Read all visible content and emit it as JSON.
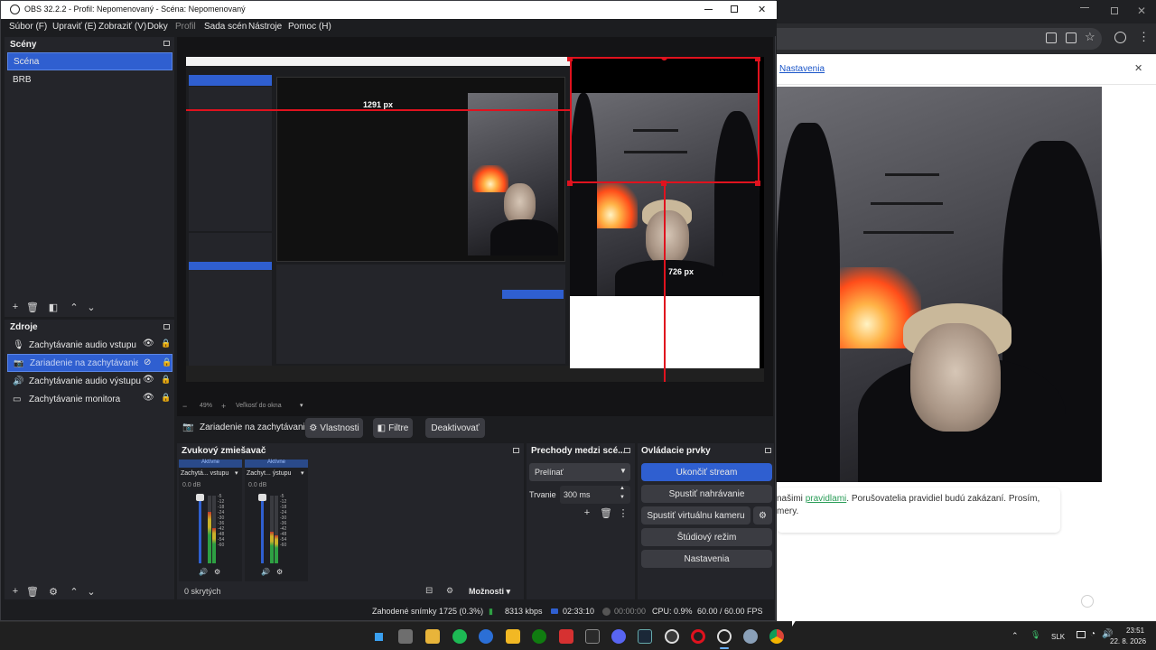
{
  "window": {
    "title": "OBS 32.2.2 - Profil: Nepomenovaný - Scéna: Nepomenovaný"
  },
  "menu": [
    "Súbor (F)",
    "Upraviť (E)",
    "Zobraziť (V)",
    "Doky",
    "Profil",
    "Sada scén",
    "Nástroje",
    "Pomoc (H)"
  ],
  "scenes": {
    "header": "Scény",
    "items": [
      "Scéna",
      "BRB"
    ],
    "selected_index": 0
  },
  "sources": {
    "header": "Zdroje",
    "items": [
      {
        "label": "Zachytávanie audio vstupu",
        "icon": "mic-icon"
      },
      {
        "label": "Zariadenie na zachytávanie vide",
        "icon": "camera-icon"
      },
      {
        "label": "Zachytávanie audio výstupu",
        "icon": "speaker-icon"
      },
      {
        "label": "Zachytávanie monitora",
        "icon": "monitor-icon"
      }
    ],
    "selected_index": 1
  },
  "preview": {
    "nested_dim_label_1": "1291 px",
    "nested_dim_label_2": "726 px",
    "main_dim_label": "726 px",
    "zoom": "49%",
    "zoom_mode": "Veľkosť do okna"
  },
  "source_toolbar": {
    "source_name": "Zariadenie na zachytávanie",
    "properties": "Vlastnosti",
    "filters": "Filtre",
    "deactivate": "Deaktivovať"
  },
  "mixer": {
    "header": "Zvukový zmiešavač",
    "channels": [
      {
        "status": "Aktívne",
        "name": "Zachytá... vstupu",
        "db": "0.0 dB"
      },
      {
        "status": "Aktívne",
        "name": "Zachyt... ýstupu",
        "db": "0.0 dB"
      }
    ],
    "scale": [
      "-5",
      "-12",
      "-18",
      "-24",
      "-30",
      "-36",
      "-42",
      "-48",
      "-54",
      "-60"
    ],
    "hidden": "0 skrytých",
    "options": "Možnosti"
  },
  "transitions": {
    "header": "Prechody medzi scé...",
    "selected": "Prelínať",
    "duration_label": "Trvanie",
    "duration_value": "300 ms"
  },
  "controls": {
    "header": "Ovládacie prvky",
    "stop_stream": "Ukončiť stream",
    "start_recording": "Spustiť nahrávanie",
    "start_virtual_camera": "Spustiť virtuálnu kameru",
    "studio_mode": "Štúdiový režim",
    "settings": "Nastavenia"
  },
  "statusbar": {
    "dropped": "Zahodené snímky 1725 (0.3%)",
    "bitrate": "8313 kbps",
    "stream_time": "02:33:10",
    "rec_time": "00:00:00",
    "cpu": "CPU: 0.9%",
    "fps": "60.00 / 60.00 FPS"
  },
  "chrome": {
    "infobar_link": "Nastavenia",
    "chat_text_1": "našimi",
    "chat_link": "pravidlami",
    "chat_text_2": ". Porušovatelia pravidiel budú zakázaní. Prosím,",
    "chat_text_3": "mery."
  },
  "taskbar": {
    "language": "SLK",
    "time": "23:51",
    "date": "22. 8. 2026"
  },
  "colors": {
    "accent_blue": "#2f5fd0",
    "panel_bg": "#24252a",
    "window_bg": "#1c1d20",
    "guide_red": "#e0121e",
    "meter_green": "#2ea043"
  }
}
